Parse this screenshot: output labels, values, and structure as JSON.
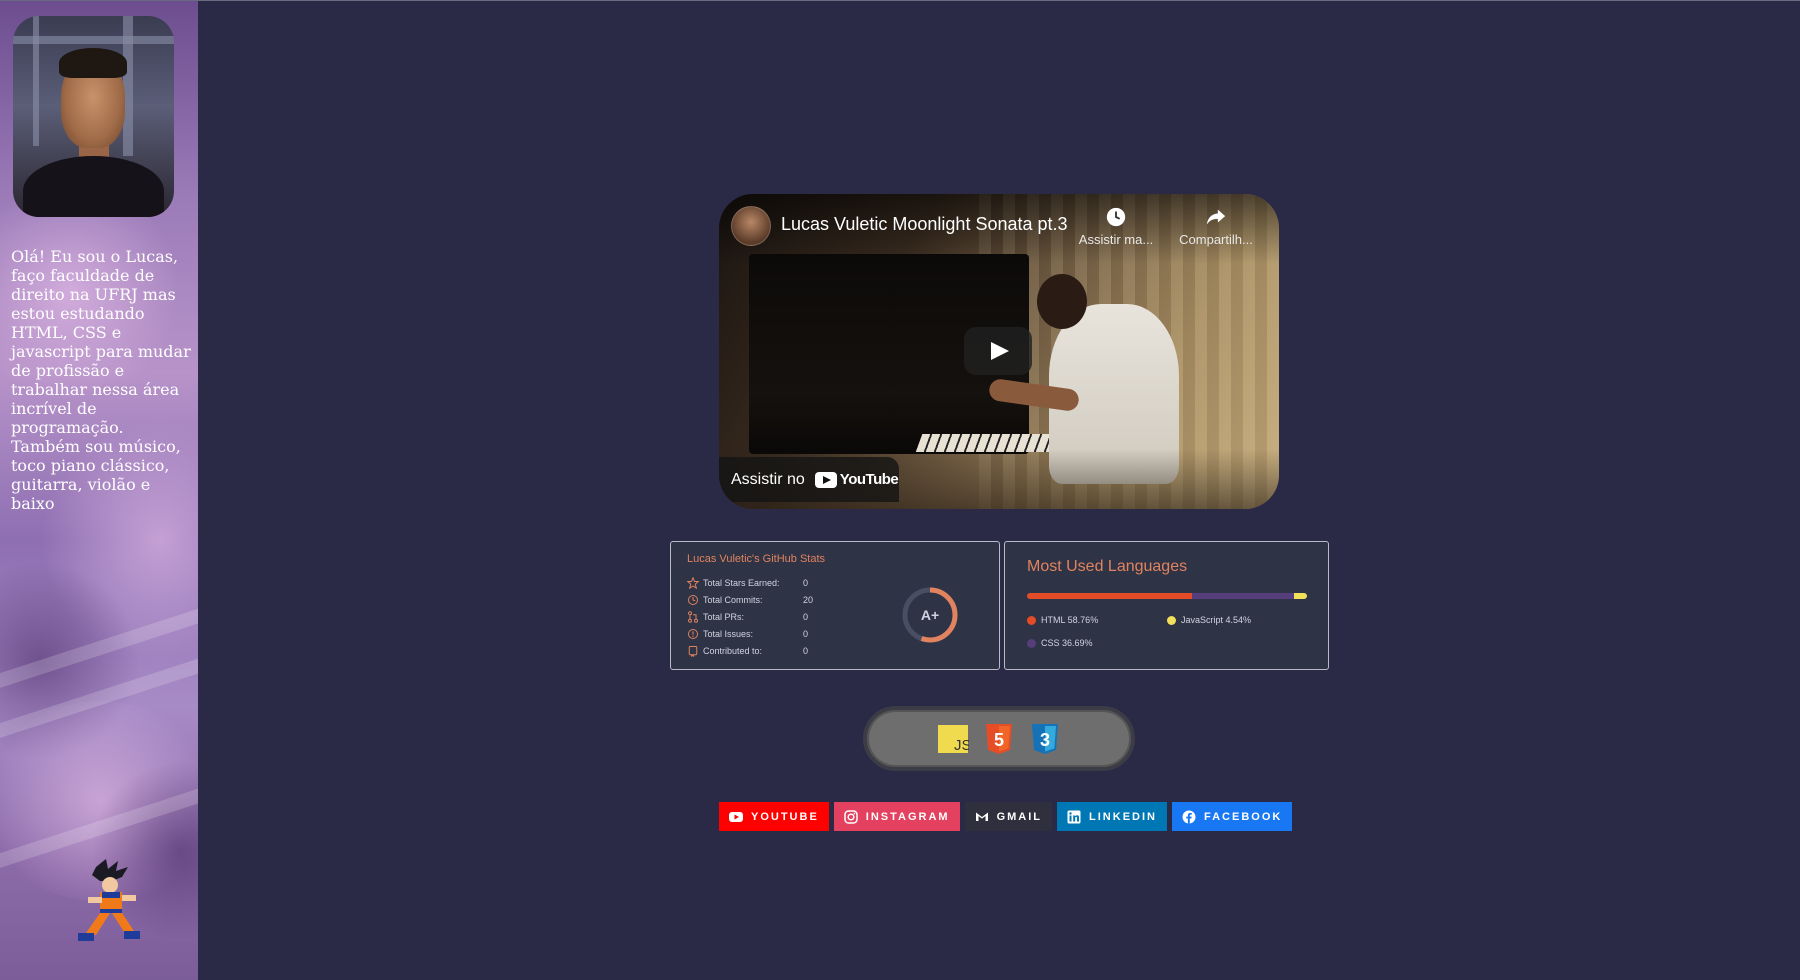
{
  "profile": {
    "bio": "Olá! Eu sou o Lucas, faço faculdade de direito na UFRJ mas estou estudando HTML, CSS e javascript para mudar de profissão e trabalhar nessa área incrível de programação. Também sou músico, toco piano clássico, guitarra, violão e baixo"
  },
  "video": {
    "title": "Lucas Vuletic Moonlight Sonata pt.3",
    "watch_later_label": "Assistir ma...",
    "share_label": "Compartilh...",
    "watch_on_label": "Assistir no",
    "youtube_word": "YouTube"
  },
  "github_stats": {
    "title": "Lucas Vuletic's GitHub Stats",
    "rank": "A+",
    "rows": [
      {
        "label": "Total Stars Earned:",
        "value": "0",
        "icon": "star-icon"
      },
      {
        "label": "Total Commits:",
        "value": "20",
        "icon": "clock-icon"
      },
      {
        "label": "Total PRs:",
        "value": "0",
        "icon": "pull-request-icon"
      },
      {
        "label": "Total Issues:",
        "value": "0",
        "icon": "issue-icon"
      },
      {
        "label": "Contributed to:",
        "value": "0",
        "icon": "repo-icon"
      }
    ]
  },
  "languages": {
    "title": "Most Used Languages",
    "items": [
      {
        "name": "HTML",
        "percent": 58.76,
        "label": "HTML 58.76%",
        "color": "#e34c26"
      },
      {
        "name": "CSS",
        "percent": 36.69,
        "label": "CSS 36.69%",
        "color": "#563d7c"
      },
      {
        "name": "JavaScript",
        "percent": 4.54,
        "label": "JavaScript 4.54%",
        "color": "#f1e05a"
      }
    ]
  },
  "tech_stack": {
    "js_label": "JS",
    "html_label": "5",
    "css_label": "3"
  },
  "socials": [
    {
      "label": "YOUTUBE",
      "color": "#ff0000",
      "icon": "youtube-icon"
    },
    {
      "label": "INSTAGRAM",
      "color": "#e4405f",
      "icon": "instagram-icon"
    },
    {
      "label": "GMAIL",
      "color": "#2f2f3e",
      "icon": "gmail-icon"
    },
    {
      "label": "LINKEDIN",
      "color": "#0077b5",
      "icon": "linkedin-icon"
    },
    {
      "label": "FACEBOOK",
      "color": "#1877f2",
      "icon": "facebook-icon"
    }
  ],
  "colors": {
    "page_background": "#2a2a46",
    "card_title": "#e0835e",
    "card_background": "#2f3346"
  }
}
